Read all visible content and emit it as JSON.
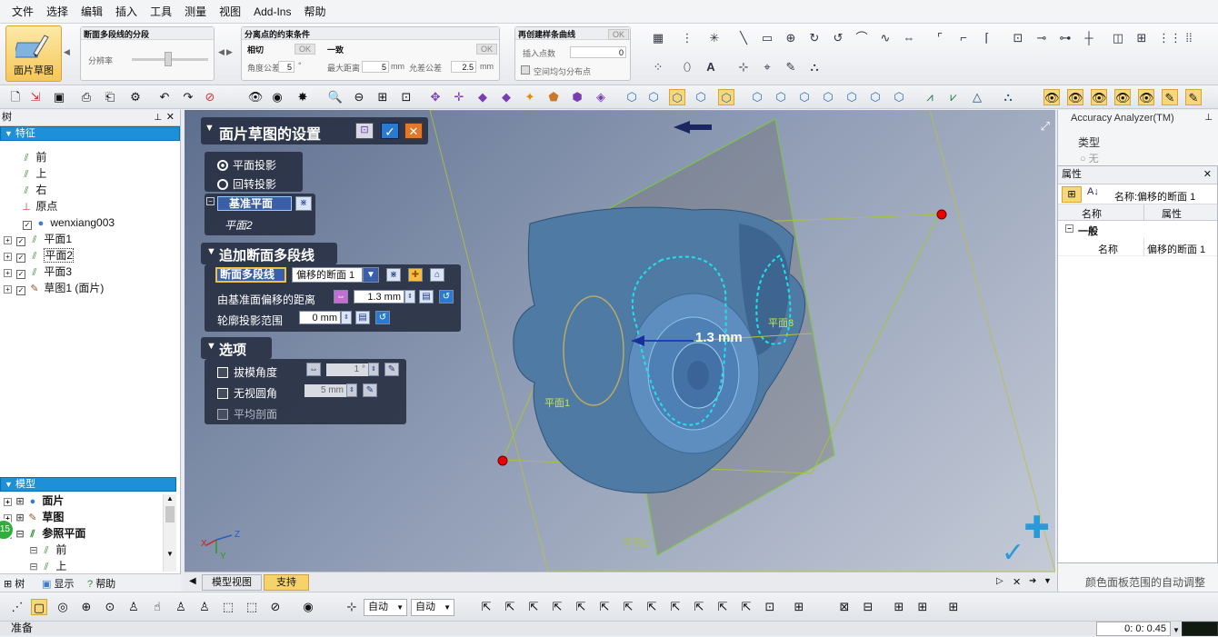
{
  "menu": [
    "文件",
    "选择",
    "编辑",
    "插入",
    "工具",
    "测量",
    "视图",
    "Add-Ins",
    "帮助"
  ],
  "ribbon": {
    "big_button": "面片草图",
    "g1_title": "断面多段线的分段",
    "g1_label": "分辨率",
    "g2_title": "分离点的约束条件",
    "g2_left": "相切",
    "g2_left_ok": "OK",
    "g2_angle_label": "角度公差",
    "g2_angle_val": "5",
    "g2_angle_unit": "°",
    "g2_right": "一致",
    "g2_right_ok": "OK",
    "g2_maxdist_label": "最大距离",
    "g2_maxdist_val": "5",
    "g2_maxdist_unit": "mm",
    "g2_tol_label": "允差公差",
    "g2_tol_val": "2.5",
    "g2_tol_unit": "mm",
    "g3_title": "再创建样条曲线",
    "g3_ok": "OK",
    "g3_label": "插入点数",
    "g3_val": "0",
    "g3_check": "空间均匀分布点"
  },
  "tree": {
    "title": "树",
    "features_header": "特征",
    "items": [
      "前",
      "上",
      "右",
      "原点",
      "wenxiang003",
      "平面1",
      "平面2",
      "平面3",
      "草图1 (面片)"
    ],
    "model_header": "模型",
    "model_items": [
      "面片",
      "草图",
      "参照平面",
      "前",
      "上"
    ],
    "tabs": [
      "树",
      "显示",
      "帮助"
    ]
  },
  "settings": {
    "title": "面片草图的设置",
    "radio1": "平面投影",
    "radio2": "回转投影",
    "base_plane": "基准平面",
    "base_plane_value": "平面2",
    "sec2_title": "追加断面多段线",
    "polyline_btn": "断面多段线",
    "polyline_sel": "偏移的断面 1",
    "offset_label": "由基准面偏移的距离",
    "offset_val": "1.3 mm",
    "range_label": "轮廓投影范围",
    "range_val": "0 mm",
    "sec3_title": "选项",
    "opt1": "拔模角度",
    "opt1_val": "1 °",
    "opt2": "无视圆角",
    "opt2_val": "5 mm",
    "opt3": "平均剖面"
  },
  "viewport": {
    "dim_label": "1.3 mm",
    "plane1": "平面1",
    "plane2": "平面2",
    "plane3": "平面3",
    "axis_z": "Z",
    "axis_x": "X",
    "axis_y": "Y",
    "tabs": [
      "模型视图",
      "支持"
    ]
  },
  "right": {
    "accuracy_title": "Accuracy Analyzer(TM)",
    "accuracy_type": "类型",
    "accuracy_none": "无",
    "props_title": "属性",
    "props_name_hdr": "名称:偏移的断面 1",
    "col_name": "名称",
    "col_prop": "属性",
    "group": "一般",
    "row_name": "名称",
    "row_value": "偏移的断面 1",
    "bottom_text": "颜色面板范围的自动调整"
  },
  "bottom": {
    "sel1": "自动",
    "sel2": "自动",
    "badge": "15"
  },
  "status": {
    "text": "准备",
    "time": "0: 0: 0.45"
  }
}
